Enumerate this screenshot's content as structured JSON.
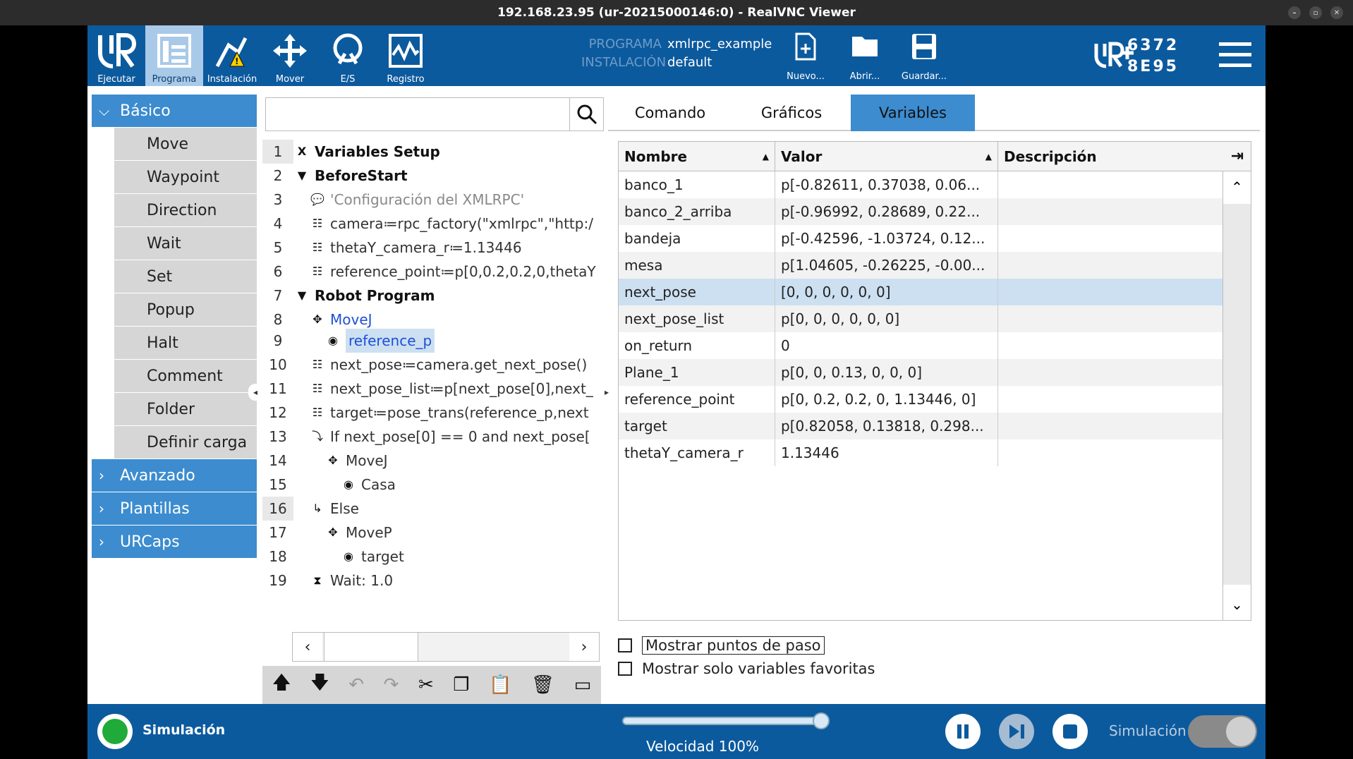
{
  "window": {
    "title": "192.168.23.95 (ur-20215000146:0) - RealVNC Viewer"
  },
  "topbar": {
    "buttons": [
      {
        "label": "Ejecutar",
        "icon": "ur-logo-icon"
      },
      {
        "label": "Programa",
        "icon": "program-icon"
      },
      {
        "label": "Instalación",
        "icon": "installation-icon"
      },
      {
        "label": "Mover",
        "icon": "move-icon"
      },
      {
        "label": "E/S",
        "icon": "io-icon"
      },
      {
        "label": "Registro",
        "icon": "log-icon"
      }
    ],
    "program_key": "PROGRAMA",
    "program_value": "xmlrpc_example",
    "installation_key": "INSTALACIÓN",
    "installation_value": "default",
    "file_buttons": [
      "Nuevo...",
      "Abrir...",
      "Guardar..."
    ],
    "serial_line1": "6372",
    "serial_line2": "8E95"
  },
  "left": {
    "basic": "Básico",
    "items": [
      "Move",
      "Waypoint",
      "Direction",
      "Wait",
      "Set",
      "Popup",
      "Halt",
      "Comment",
      "Folder",
      "Definir carga"
    ],
    "advanced": "Avanzado",
    "templates": "Plantillas",
    "urcaps": "URCaps"
  },
  "tree": {
    "search_placeholder": "",
    "lines": [
      {
        "n": "1",
        "text": "Variables Setup",
        "style": "bold",
        "indent": 0,
        "icon": "X"
      },
      {
        "n": "2",
        "text": "BeforeStart",
        "style": "bold",
        "indent": 0,
        "icon": "▼"
      },
      {
        "n": "3",
        "text": "'Configuración del XMLRPC'",
        "style": "grey",
        "indent": 1,
        "icon": "💬"
      },
      {
        "n": "4",
        "text": "camera≔rpc_factory(\"xmlrpc\",\"http:/",
        "style": "",
        "indent": 1,
        "icon": "☷"
      },
      {
        "n": "5",
        "text": "thetaY_camera_r≔1.13446",
        "style": "",
        "indent": 1,
        "icon": "☷"
      },
      {
        "n": "6",
        "text": "reference_point≔p[0,0.2,0.2,0,thetaY",
        "style": "",
        "indent": 1,
        "icon": "☷"
      },
      {
        "n": "7",
        "text": "Robot Program",
        "style": "bold",
        "indent": 0,
        "icon": "▼"
      },
      {
        "n": "8",
        "text": "MoveJ",
        "style": "blue",
        "indent": 1,
        "icon": "✥"
      },
      {
        "n": "9",
        "text": "reference_p",
        "style": "blue-sel",
        "indent": 2,
        "icon": "◉"
      },
      {
        "n": "10",
        "text": "next_pose≔camera.get_next_pose()",
        "style": "",
        "indent": 1,
        "icon": "☷"
      },
      {
        "n": "11",
        "text": "next_pose_list≔p[next_pose[0],next_",
        "style": "",
        "indent": 1,
        "icon": "☷"
      },
      {
        "n": "12",
        "text": "target≔pose_trans(reference_p,next",
        "style": "",
        "indent": 1,
        "icon": "☷"
      },
      {
        "n": "13",
        "text": "If next_pose[0] == 0 and next_pose[",
        "style": "",
        "indent": 1,
        "icon": "⤵"
      },
      {
        "n": "14",
        "text": "MoveJ",
        "style": "",
        "indent": 2,
        "icon": "✥"
      },
      {
        "n": "15",
        "text": "Casa",
        "style": "",
        "indent": 3,
        "icon": "◉"
      },
      {
        "n": "16",
        "text": "Else",
        "style": "",
        "indent": 1,
        "icon": "↳"
      },
      {
        "n": "17",
        "text": "MoveP",
        "style": "",
        "indent": 2,
        "icon": "✥"
      },
      {
        "n": "18",
        "text": "target",
        "style": "",
        "indent": 3,
        "icon": "◉"
      },
      {
        "n": "19",
        "text": "Wait: 1.0",
        "style": "",
        "indent": 1,
        "icon": "⧗"
      }
    ]
  },
  "tabs": [
    "Comando",
    "Gráficos",
    "Variables"
  ],
  "table": {
    "headers": [
      "Nombre",
      "Valor",
      "Descripción"
    ],
    "rows": [
      {
        "name": "banco_1",
        "value": "p[-0.82611, 0.37038, 0.06...",
        "desc": ""
      },
      {
        "name": "banco_2_arriba",
        "value": "p[-0.96992, 0.28689, 0.22...",
        "desc": ""
      },
      {
        "name": "bandeja",
        "value": "p[-0.42596, -1.03724, 0.12...",
        "desc": ""
      },
      {
        "name": "mesa",
        "value": "p[1.04605, -0.26225, -0.00...",
        "desc": ""
      },
      {
        "name": "next_pose",
        "value": "[0, 0, 0, 0, 0, 0]",
        "desc": ""
      },
      {
        "name": "next_pose_list",
        "value": "p[0, 0, 0, 0, 0, 0]",
        "desc": ""
      },
      {
        "name": "on_return",
        "value": "0",
        "desc": ""
      },
      {
        "name": "Plane_1",
        "value": "p[0, 0, 0.13, 0, 0, 0]",
        "desc": ""
      },
      {
        "name": "reference_point",
        "value": "p[0, 0.2, 0.2, 0, 1.13446, 0]",
        "desc": ""
      },
      {
        "name": "target",
        "value": "p[0.82058, 0.13818, 0.298...",
        "desc": ""
      },
      {
        "name": "thetaY_camera_r",
        "value": "1.13446",
        "desc": ""
      }
    ],
    "selected_row": 4
  },
  "checkboxes": [
    "Mostrar puntos de paso",
    "Mostrar solo variables favoritas"
  ],
  "bottom": {
    "status": "Simulación",
    "speed": "Velocidad 100%",
    "speed_fraction": 1.0,
    "sim_label": "Simulación"
  },
  "colors": {
    "brand": "#0c5a9e",
    "accent": "#3c8ccf",
    "status_ok": "#1faa3a"
  }
}
